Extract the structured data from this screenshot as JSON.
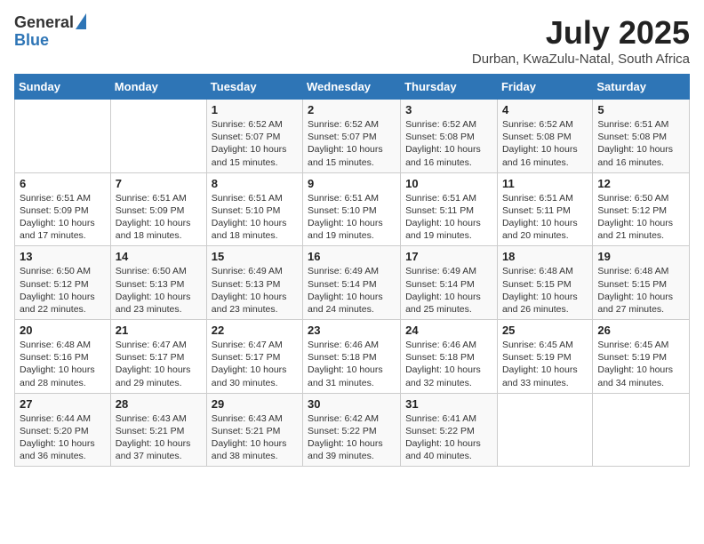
{
  "logo": {
    "general": "General",
    "blue": "Blue"
  },
  "header": {
    "title": "July 2025",
    "subtitle": "Durban, KwaZulu-Natal, South Africa"
  },
  "days_of_week": [
    "Sunday",
    "Monday",
    "Tuesday",
    "Wednesday",
    "Thursday",
    "Friday",
    "Saturday"
  ],
  "weeks": [
    [
      {
        "day": "",
        "info": ""
      },
      {
        "day": "",
        "info": ""
      },
      {
        "day": "1",
        "info": "Sunrise: 6:52 AM\nSunset: 5:07 PM\nDaylight: 10 hours and 15 minutes."
      },
      {
        "day": "2",
        "info": "Sunrise: 6:52 AM\nSunset: 5:07 PM\nDaylight: 10 hours and 15 minutes."
      },
      {
        "day": "3",
        "info": "Sunrise: 6:52 AM\nSunset: 5:08 PM\nDaylight: 10 hours and 16 minutes."
      },
      {
        "day": "4",
        "info": "Sunrise: 6:52 AM\nSunset: 5:08 PM\nDaylight: 10 hours and 16 minutes."
      },
      {
        "day": "5",
        "info": "Sunrise: 6:51 AM\nSunset: 5:08 PM\nDaylight: 10 hours and 16 minutes."
      }
    ],
    [
      {
        "day": "6",
        "info": "Sunrise: 6:51 AM\nSunset: 5:09 PM\nDaylight: 10 hours and 17 minutes."
      },
      {
        "day": "7",
        "info": "Sunrise: 6:51 AM\nSunset: 5:09 PM\nDaylight: 10 hours and 18 minutes."
      },
      {
        "day": "8",
        "info": "Sunrise: 6:51 AM\nSunset: 5:10 PM\nDaylight: 10 hours and 18 minutes."
      },
      {
        "day": "9",
        "info": "Sunrise: 6:51 AM\nSunset: 5:10 PM\nDaylight: 10 hours and 19 minutes."
      },
      {
        "day": "10",
        "info": "Sunrise: 6:51 AM\nSunset: 5:11 PM\nDaylight: 10 hours and 19 minutes."
      },
      {
        "day": "11",
        "info": "Sunrise: 6:51 AM\nSunset: 5:11 PM\nDaylight: 10 hours and 20 minutes."
      },
      {
        "day": "12",
        "info": "Sunrise: 6:50 AM\nSunset: 5:12 PM\nDaylight: 10 hours and 21 minutes."
      }
    ],
    [
      {
        "day": "13",
        "info": "Sunrise: 6:50 AM\nSunset: 5:12 PM\nDaylight: 10 hours and 22 minutes."
      },
      {
        "day": "14",
        "info": "Sunrise: 6:50 AM\nSunset: 5:13 PM\nDaylight: 10 hours and 23 minutes."
      },
      {
        "day": "15",
        "info": "Sunrise: 6:49 AM\nSunset: 5:13 PM\nDaylight: 10 hours and 23 minutes."
      },
      {
        "day": "16",
        "info": "Sunrise: 6:49 AM\nSunset: 5:14 PM\nDaylight: 10 hours and 24 minutes."
      },
      {
        "day": "17",
        "info": "Sunrise: 6:49 AM\nSunset: 5:14 PM\nDaylight: 10 hours and 25 minutes."
      },
      {
        "day": "18",
        "info": "Sunrise: 6:48 AM\nSunset: 5:15 PM\nDaylight: 10 hours and 26 minutes."
      },
      {
        "day": "19",
        "info": "Sunrise: 6:48 AM\nSunset: 5:15 PM\nDaylight: 10 hours and 27 minutes."
      }
    ],
    [
      {
        "day": "20",
        "info": "Sunrise: 6:48 AM\nSunset: 5:16 PM\nDaylight: 10 hours and 28 minutes."
      },
      {
        "day": "21",
        "info": "Sunrise: 6:47 AM\nSunset: 5:17 PM\nDaylight: 10 hours and 29 minutes."
      },
      {
        "day": "22",
        "info": "Sunrise: 6:47 AM\nSunset: 5:17 PM\nDaylight: 10 hours and 30 minutes."
      },
      {
        "day": "23",
        "info": "Sunrise: 6:46 AM\nSunset: 5:18 PM\nDaylight: 10 hours and 31 minutes."
      },
      {
        "day": "24",
        "info": "Sunrise: 6:46 AM\nSunset: 5:18 PM\nDaylight: 10 hours and 32 minutes."
      },
      {
        "day": "25",
        "info": "Sunrise: 6:45 AM\nSunset: 5:19 PM\nDaylight: 10 hours and 33 minutes."
      },
      {
        "day": "26",
        "info": "Sunrise: 6:45 AM\nSunset: 5:19 PM\nDaylight: 10 hours and 34 minutes."
      }
    ],
    [
      {
        "day": "27",
        "info": "Sunrise: 6:44 AM\nSunset: 5:20 PM\nDaylight: 10 hours and 36 minutes."
      },
      {
        "day": "28",
        "info": "Sunrise: 6:43 AM\nSunset: 5:21 PM\nDaylight: 10 hours and 37 minutes."
      },
      {
        "day": "29",
        "info": "Sunrise: 6:43 AM\nSunset: 5:21 PM\nDaylight: 10 hours and 38 minutes."
      },
      {
        "day": "30",
        "info": "Sunrise: 6:42 AM\nSunset: 5:22 PM\nDaylight: 10 hours and 39 minutes."
      },
      {
        "day": "31",
        "info": "Sunrise: 6:41 AM\nSunset: 5:22 PM\nDaylight: 10 hours and 40 minutes."
      },
      {
        "day": "",
        "info": ""
      },
      {
        "day": "",
        "info": ""
      }
    ]
  ]
}
